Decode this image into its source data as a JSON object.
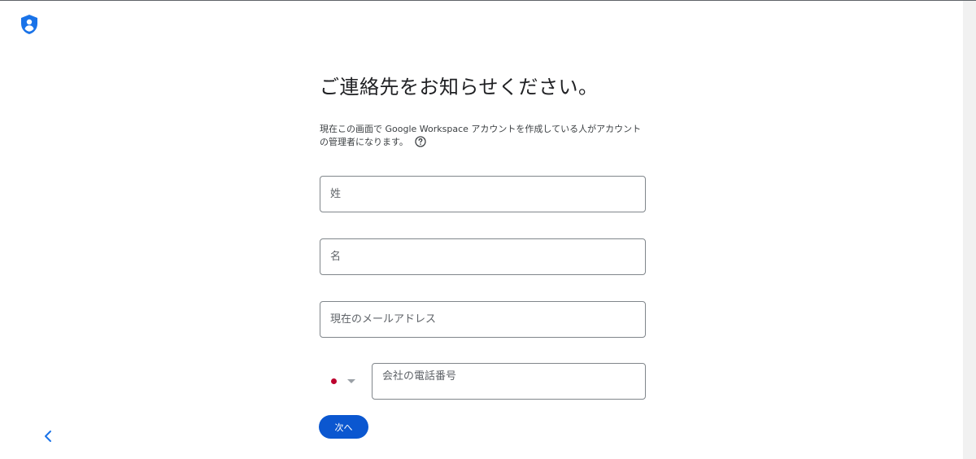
{
  "header": {
    "logo_icon": "admin-shield-person-icon",
    "brand_color": "#1a73e8"
  },
  "main": {
    "title": "ご連絡先をお知らせください。",
    "description": "現在この画面で Google Workspace アカウントを作成している人がアカウントの管理者になります。",
    "help_icon": "help-circle-icon",
    "fields": {
      "last_name": {
        "placeholder": "姓",
        "value": ""
      },
      "first_name": {
        "placeholder": "名",
        "value": ""
      },
      "email": {
        "placeholder": "現在のメールアドレス",
        "value": ""
      },
      "phone": {
        "placeholder": "会社の電話番号",
        "value": "",
        "country_flag": "japan-flag-icon",
        "country_color": "#bc002d"
      }
    },
    "next_label": "次へ",
    "next_color": "#0b57d0"
  },
  "nav": {
    "back_icon": "chevron-left-icon"
  }
}
